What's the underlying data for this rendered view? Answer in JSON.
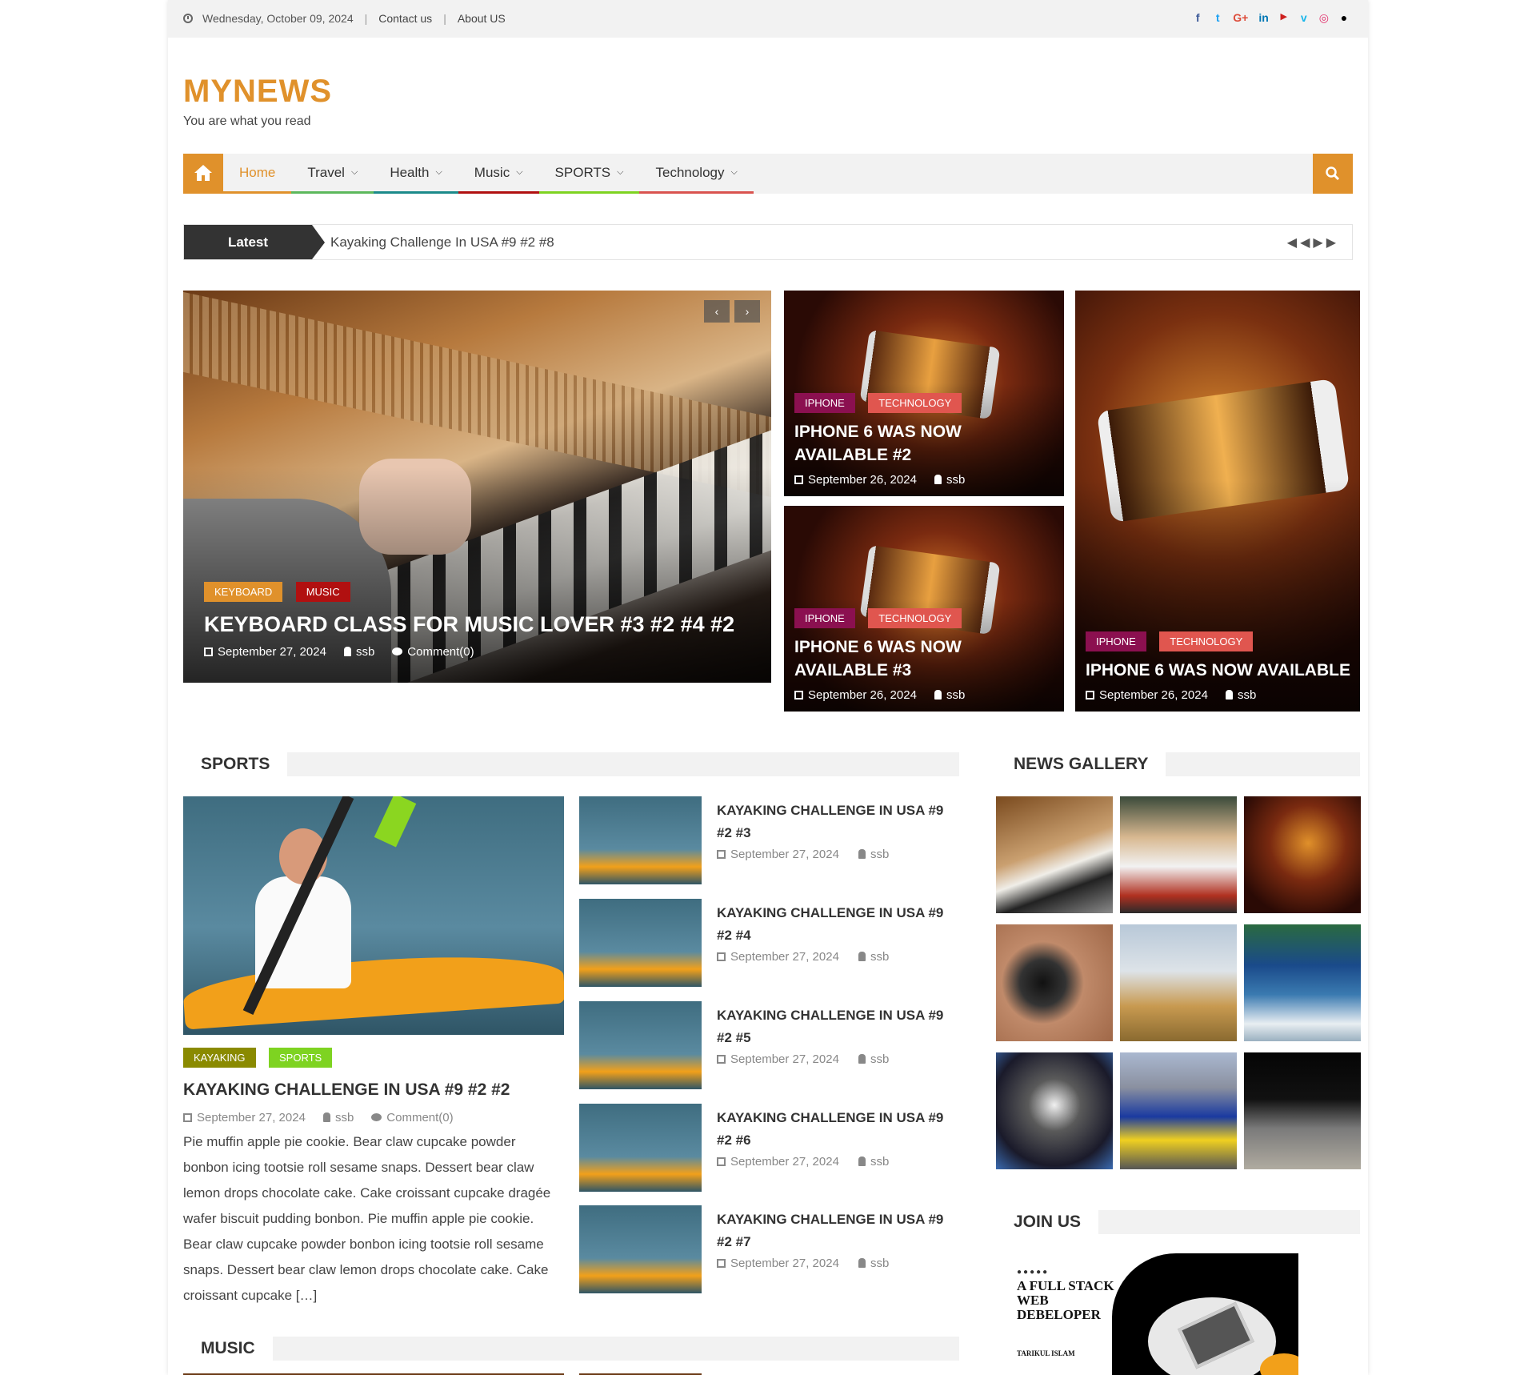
{
  "topbar": {
    "date": "Wednesday, October 09, 2024",
    "links": [
      "Contact us",
      "About US"
    ],
    "social": [
      {
        "icon": "facebook-icon",
        "glyph": "f",
        "color": "#3b5998"
      },
      {
        "icon": "twitter-icon",
        "glyph": "t",
        "color": "#1da1f2"
      },
      {
        "icon": "google-plus-icon",
        "glyph": "G+",
        "color": "#dd4b39"
      },
      {
        "icon": "linkedin-icon",
        "glyph": "in",
        "color": "#0077b5"
      },
      {
        "icon": "youtube-icon",
        "glyph": "▶",
        "color": "#cd201f"
      },
      {
        "icon": "vimeo-icon",
        "glyph": "v",
        "color": "#1ab7ea"
      },
      {
        "icon": "instagram-icon",
        "glyph": "◎",
        "color": "#e1306c"
      },
      {
        "icon": "tripadvisor-icon",
        "glyph": "●",
        "color": "#000000"
      }
    ]
  },
  "brand": {
    "title": "MYNEWS",
    "tagline": "You are what you read"
  },
  "nav": {
    "items": [
      {
        "label": "Home",
        "color": "#e0912b",
        "dropdown": false
      },
      {
        "label": "Travel",
        "color": "#5cb85c",
        "dropdown": true
      },
      {
        "label": "Health",
        "color": "#1b8a8a",
        "dropdown": true
      },
      {
        "label": "Music",
        "color": "#b11010",
        "dropdown": true
      },
      {
        "label": "SPORTS",
        "color": "#7ed321",
        "dropdown": true
      },
      {
        "label": "Technology",
        "color": "#d9534f",
        "dropdown": true
      }
    ]
  },
  "ticker": {
    "label": "Latest",
    "text": "Kayaking Challenge In USA #9 #2 #8"
  },
  "featured": {
    "main": {
      "badges": [
        {
          "label": "KEYBOARD",
          "color": "#e0912b"
        },
        {
          "label": "MUSIC",
          "color": "#b11010"
        }
      ],
      "title": "KEYBOARD CLASS FOR MUSIC LOVER #3 #2 #4 #2",
      "date": "September 27, 2024",
      "author": "ssb",
      "comments": "Comment(0)"
    },
    "side": [
      {
        "badges": [
          {
            "label": "IPHONE",
            "color": "#8b1050"
          },
          {
            "label": "TECHNOLOGY",
            "color": "#e0564f"
          }
        ],
        "title": "IPHONE 6 WAS NOW AVAILABLE #2",
        "date": "September 26, 2024",
        "author": "ssb"
      },
      {
        "badges": [
          {
            "label": "IPHONE",
            "color": "#8b1050"
          },
          {
            "label": "TECHNOLOGY",
            "color": "#e0564f"
          }
        ],
        "title": "IPHONE 6 WAS NOW AVAILABLE #3",
        "date": "September 26, 2024",
        "author": "ssb"
      },
      {
        "badges": [
          {
            "label": "IPHONE",
            "color": "#8b1050"
          },
          {
            "label": "TECHNOLOGY",
            "color": "#e0564f"
          }
        ],
        "title": "IPHONE 6 WAS NOW AVAILABLE",
        "date": "September 26, 2024",
        "author": "ssb"
      }
    ]
  },
  "sports": {
    "heading": "SPORTS",
    "accent": "#7ed321",
    "main": {
      "badges": [
        {
          "label": "KAYAKING",
          "color": "#8a8a00"
        },
        {
          "label": "SPORTS",
          "color": "#7ed321"
        }
      ],
      "title": "KAYAKING CHALLENGE IN USA #9 #2 #2",
      "date": "September 27, 2024",
      "author": "ssb",
      "comments": "Comment(0)",
      "excerpt": "Pie muffin apple pie cookie. Bear claw cupcake powder bonbon icing tootsie roll sesame snaps. Dessert bear claw lemon drops chocolate cake. Cake croissant cupcake dragée wafer biscuit pudding bonbon. Pie muffin apple pie cookie. Bear claw cupcake powder bonbon icing tootsie roll sesame snaps. Dessert bear claw lemon drops chocolate cake. Cake croissant cupcake […]"
    },
    "list": [
      {
        "title": "KAYAKING CHALLENGE IN USA #9 #2 #3",
        "date": "September 27, 2024",
        "author": "ssb"
      },
      {
        "title": "KAYAKING CHALLENGE IN USA #9 #2 #4",
        "date": "September 27, 2024",
        "author": "ssb"
      },
      {
        "title": "KAYAKING CHALLENGE IN USA #9 #2 #5",
        "date": "September 27, 2024",
        "author": "ssb"
      },
      {
        "title": "KAYAKING CHALLENGE IN USA #9 #2 #6",
        "date": "September 27, 2024",
        "author": "ssb"
      },
      {
        "title": "KAYAKING CHALLENGE IN USA #9 #2 #7",
        "date": "September 27, 2024",
        "author": "ssb"
      }
    ]
  },
  "gallery": {
    "heading": "NEWS GALLERY"
  },
  "join": {
    "heading": "JOIN US",
    "ad_lines": [
      "A FULL STACK",
      "WEB",
      "DEBELOPER"
    ],
    "ad_author": "TARIKUL ISLAM"
  },
  "music": {
    "heading": "MUSIC",
    "accent": "#b11010"
  }
}
